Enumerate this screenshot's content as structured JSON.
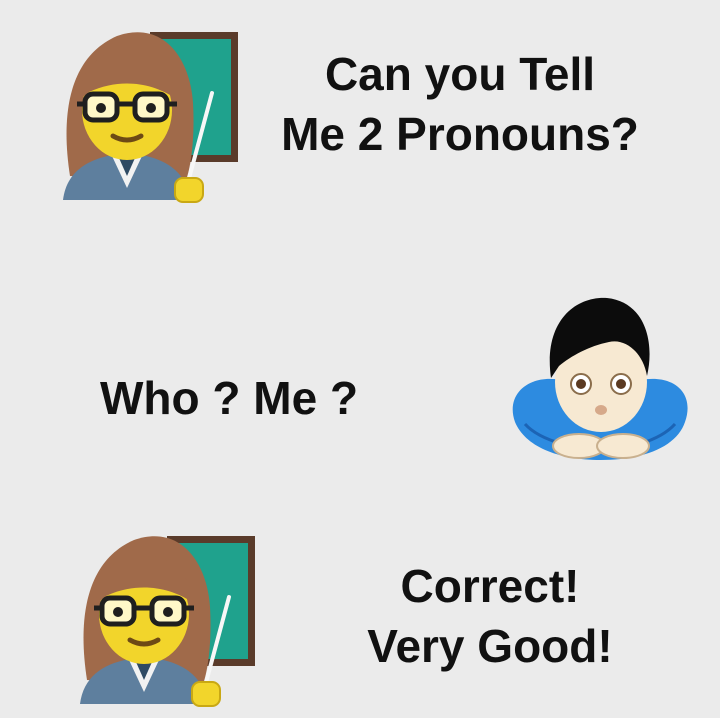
{
  "panels": [
    {
      "speaker": "teacher-icon",
      "lines": [
        "Can you Tell",
        "Me 2 Pronouns?"
      ]
    },
    {
      "speaker": "boy-icon",
      "lines": [
        "Who ? Me ?"
      ]
    },
    {
      "speaker": "teacher-icon",
      "lines": [
        "Correct!",
        "Very Good!"
      ]
    }
  ],
  "colors": {
    "background": "#ebebeb",
    "text": "#111111",
    "hair_teacher": "#a06a4a",
    "skin": "#f2d52b",
    "chalkboard": "#1fa28d",
    "chalkboard_frame": "#5a3b2a",
    "blazer": "#5e7f9e",
    "boy_hair": "#0c0c0c",
    "boy_skin": "#f7e9d2",
    "boy_shirt": "#2d8be0"
  }
}
